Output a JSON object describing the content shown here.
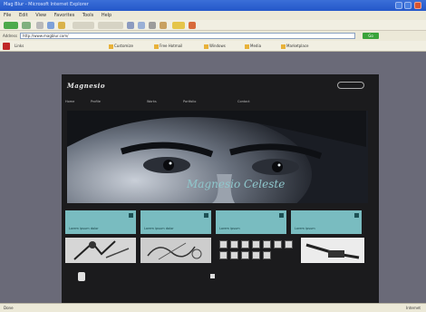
{
  "window": {
    "title": "Mag Blur - Microsoft Internet Explorer"
  },
  "menu": [
    "File",
    "Edit",
    "View",
    "Favorites",
    "Tools",
    "Help"
  ],
  "address": {
    "label": "Address",
    "url": "http://www.magblur.com/",
    "go": "Go"
  },
  "links": [
    "Links",
    "Customize",
    "Free Hotmail",
    "Windows",
    "Media",
    "Marketplace"
  ],
  "site": {
    "logo": "Magnesio",
    "tagline": "",
    "badge": "",
    "nav": [
      "Home",
      "Profile",
      "Works",
      "Portfolio",
      "Contact"
    ],
    "hero_title": "Magnesio Celeste",
    "panels": [
      {
        "label": "Lorem ipsum dolor"
      },
      {
        "label": "Lorem ipsum dolor"
      },
      {
        "label": "Lorem ipsum"
      },
      {
        "label": "Lorem ipsum"
      }
    ],
    "footer_icon_label": "",
    "news_title": "",
    "news_sub": ""
  },
  "status": {
    "text": "Done",
    "zone": "Internet"
  },
  "colors": {
    "accent": "#79bcc0",
    "hero_text": "#8fc7cc",
    "site_bg": "#1b1b1d"
  }
}
